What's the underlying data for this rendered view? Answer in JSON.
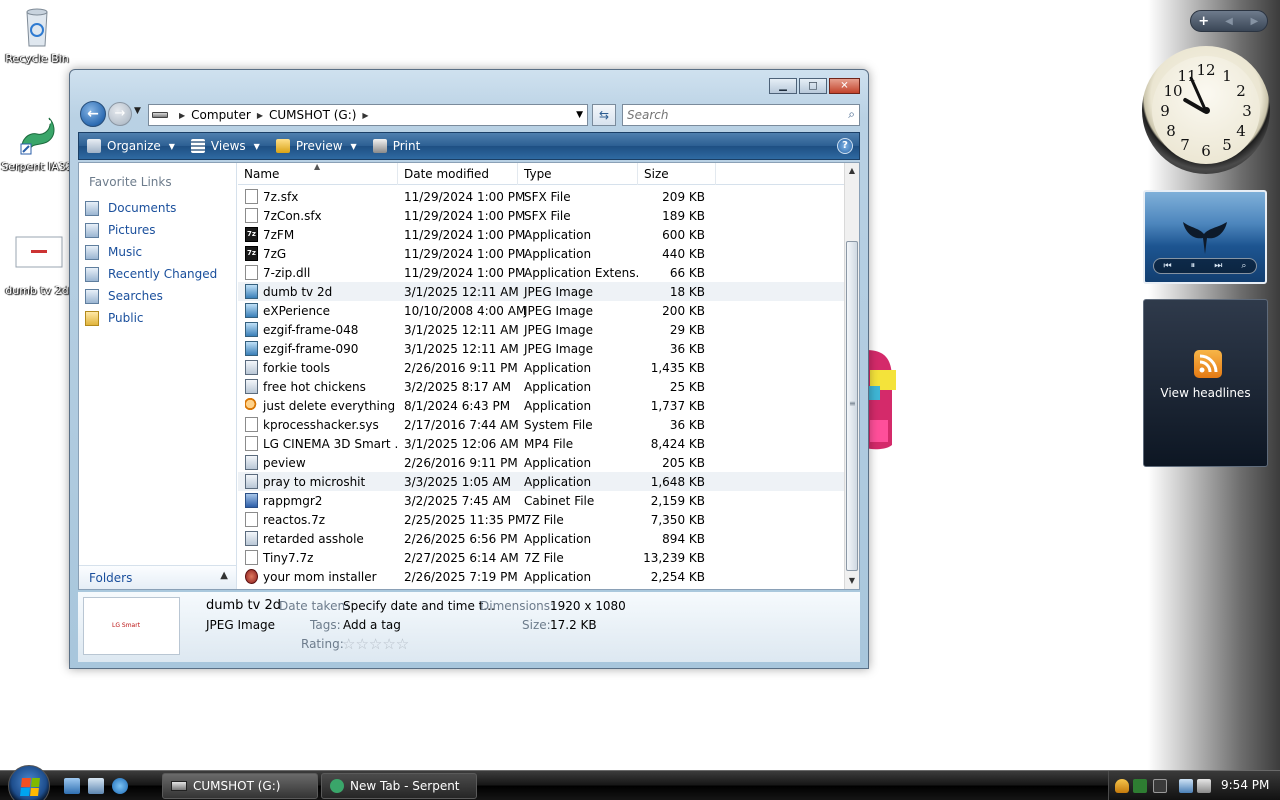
{
  "desktop": {
    "icons": [
      {
        "label": "Recycle Bin"
      },
      {
        "label": "Serpent IA32"
      },
      {
        "label": "dumb tv 2d"
      }
    ]
  },
  "sidebar": {
    "controls": {
      "add": "+",
      "prev": "◀",
      "next": "▶"
    },
    "clock_numbers": [
      "12",
      "1",
      "2",
      "3",
      "4",
      "5",
      "6",
      "7",
      "8",
      "9",
      "10",
      "11"
    ],
    "feed_label": "View headlines"
  },
  "window": {
    "address": {
      "computer": "Computer",
      "drive": "CUMSHOT (G:)"
    },
    "search": {
      "placeholder": "Search"
    },
    "toolbar": {
      "organize": "Organize",
      "views": "Views",
      "preview": "Preview",
      "print": "Print",
      "help": "?"
    },
    "nav_pane": {
      "title": "Favorite Links",
      "links": [
        "Documents",
        "Pictures",
        "Music",
        "Recently Changed",
        "Searches",
        "Public"
      ],
      "folders_label": "Folders"
    },
    "columns": {
      "name": "Name",
      "date": "Date modified",
      "type": "Type",
      "size": "Size"
    },
    "files": [
      {
        "name": "7z.sfx",
        "date": "11/29/2024 1:00 PM",
        "type": "SFX File",
        "size": "209 KB",
        "icon": "file"
      },
      {
        "name": "7zCon.sfx",
        "date": "11/29/2024 1:00 PM",
        "type": "SFX File",
        "size": "189 KB",
        "icon": "file"
      },
      {
        "name": "7zFM",
        "date": "11/29/2024 1:00 PM",
        "type": "Application",
        "size": "600 KB",
        "icon": "7z"
      },
      {
        "name": "7zG",
        "date": "11/29/2024 1:00 PM",
        "type": "Application",
        "size": "440 KB",
        "icon": "7z"
      },
      {
        "name": "7-zip.dll",
        "date": "11/29/2024 1:00 PM",
        "type": "Application Extens...",
        "size": "66 KB",
        "icon": "file"
      },
      {
        "name": "dumb tv 2d",
        "date": "3/1/2025 12:11 AM",
        "type": "JPEG Image",
        "size": "18 KB",
        "icon": "image",
        "selected": true
      },
      {
        "name": "eXPerience",
        "date": "10/10/2008 4:00 AM",
        "type": "JPEG Image",
        "size": "200 KB",
        "icon": "image"
      },
      {
        "name": "ezgif-frame-048",
        "date": "3/1/2025 12:11 AM",
        "type": "JPEG Image",
        "size": "29 KB",
        "icon": "image"
      },
      {
        "name": "ezgif-frame-090",
        "date": "3/1/2025 12:11 AM",
        "type": "JPEG Image",
        "size": "36 KB",
        "icon": "image"
      },
      {
        "name": "forkie tools",
        "date": "2/26/2016 9:11 PM",
        "type": "Application",
        "size": "1,435 KB",
        "icon": "app"
      },
      {
        "name": "free hot chickens",
        "date": "3/2/2025 8:17 AM",
        "type": "Application",
        "size": "25 KB",
        "icon": "app"
      },
      {
        "name": "just delete everything",
        "date": "8/1/2024 6:43 PM",
        "type": "Application",
        "size": "1,737 KB",
        "icon": "magnifier"
      },
      {
        "name": "kprocesshacker.sys",
        "date": "2/17/2016 7:44 AM",
        "type": "System File",
        "size": "36 KB",
        "icon": "file"
      },
      {
        "name": "LG CINEMA 3D Smart ...",
        "date": "3/1/2025 12:06 AM",
        "type": "MP4 File",
        "size": "8,424 KB",
        "icon": "file"
      },
      {
        "name": "peview",
        "date": "2/26/2016 9:11 PM",
        "type": "Application",
        "size": "205 KB",
        "icon": "app"
      },
      {
        "name": "pray to microshit",
        "date": "3/3/2025 1:05 AM",
        "type": "Application",
        "size": "1,648 KB",
        "icon": "app",
        "selected": true
      },
      {
        "name": "rappmgr2",
        "date": "3/2/2025 7:45 AM",
        "type": "Cabinet File",
        "size": "2,159 KB",
        "icon": "cab"
      },
      {
        "name": "reactos.7z",
        "date": "2/25/2025 11:35 PM",
        "type": "7Z File",
        "size": "7,350 KB",
        "icon": "file"
      },
      {
        "name": "retarded asshole",
        "date": "2/26/2025 6:56 PM",
        "type": "Application",
        "size": "894 KB",
        "icon": "app"
      },
      {
        "name": "Tiny7.7z",
        "date": "2/27/2025 6:14 AM",
        "type": "7Z File",
        "size": "13,239 KB",
        "icon": "file"
      },
      {
        "name": "your mom installer",
        "date": "2/26/2025 7:19 PM",
        "type": "Application",
        "size": "2,254 KB",
        "icon": "installer"
      }
    ],
    "details": {
      "name": "dumb tv 2d",
      "type": "JPEG Image",
      "date_taken_label": "Date taken:",
      "date_taken_value": "Specify date and time t...",
      "tags_label": "Tags:",
      "tags_value": "Add a tag",
      "rating_label": "Rating:",
      "rating_stars": "☆☆☆☆☆",
      "dimensions_label": "Dimensions:",
      "dimensions_value": "1920 x 1080",
      "size_label": "Size:",
      "size_value": "17.2 KB",
      "thumb_text": "LG Smart"
    }
  },
  "taskbar": {
    "tasks": [
      {
        "label": "CUMSHOT (G:)"
      },
      {
        "label": "New Tab - Serpent"
      }
    ],
    "time": "9:54 PM"
  },
  "colors": {
    "toolbar_blue": "#2c5f93",
    "link_blue": "#1a4f9c",
    "selection": "#eef2f6"
  }
}
